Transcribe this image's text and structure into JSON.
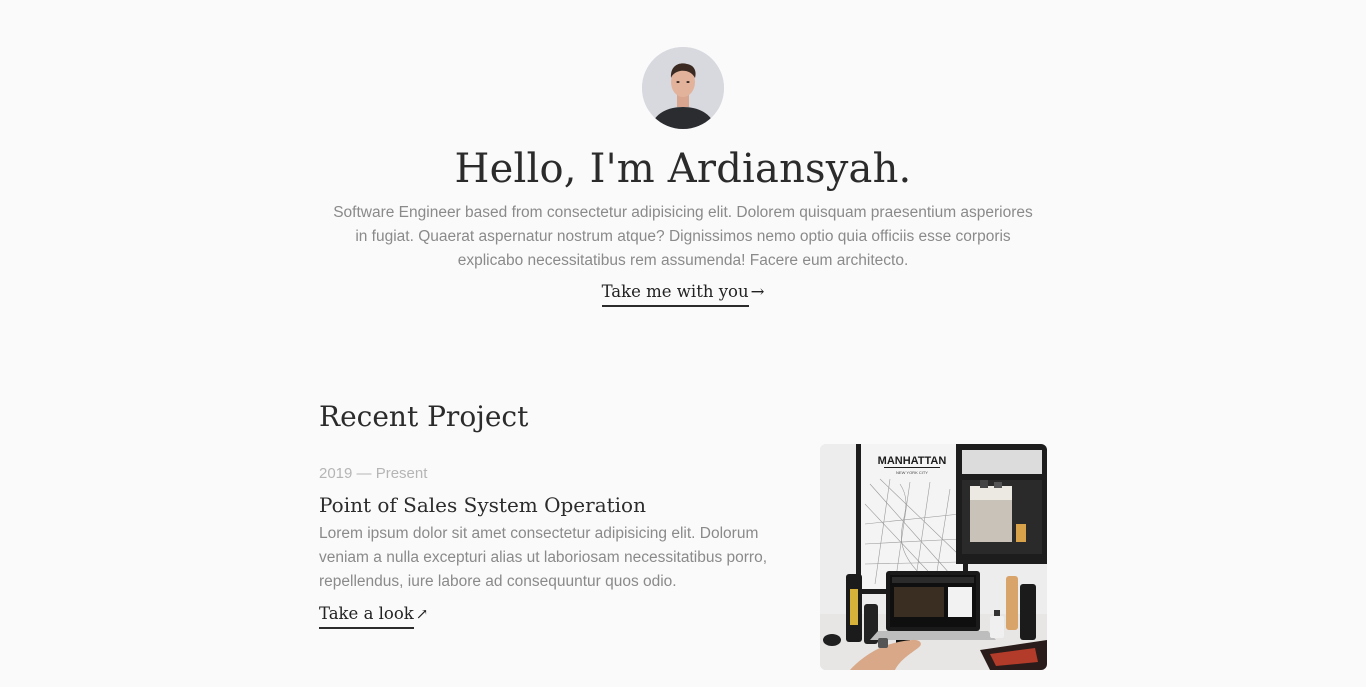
{
  "hero": {
    "title": "Hello, I'm Ardiansyah.",
    "description": "Software Engineer based from consectetur adipisicing elit. Dolorem quisquam praesentium asperiores in fugiat. Quaerat aspernatur nostrum atque? Dignissimos nemo optio quia officiis esse corporis explicabo necessitatibus rem assumenda! Facere eum architecto.",
    "cta_label": "Take me with you",
    "cta_arrow": "→"
  },
  "projects_section": {
    "title": "Recent Project",
    "items": [
      {
        "date": "2019 — Present",
        "title": "Point of Sales System Operation",
        "description": "Lorem ipsum dolor sit amet consectetur adipisicing elit. Dolorum veniam a nulla excepturi alias ut laboriosam necessitatibus porro, repellendus, iure labore ad consequuntur quos odio.",
        "link_label": "Take a look",
        "link_arrow": "↗",
        "image": {
          "poster_title": "MANHATTAN",
          "poster_subtitle": "NEW YORK CITY"
        }
      }
    ]
  },
  "colors": {
    "background": "#fafafa",
    "heading": "#2b2b2b",
    "body_text": "#8a8a8a",
    "muted_text": "#b5b5b5"
  }
}
